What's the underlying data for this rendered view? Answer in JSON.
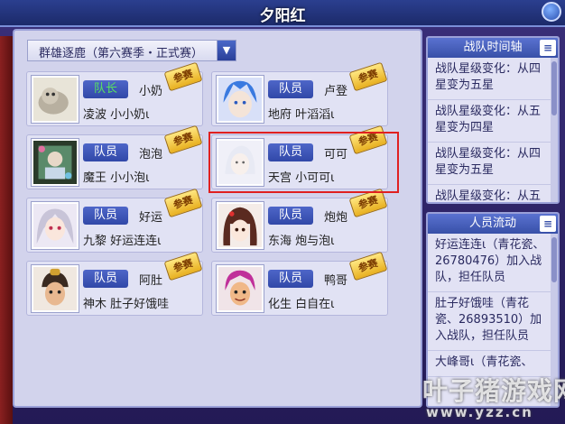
{
  "window": {
    "title": "夕阳红"
  },
  "season_select": {
    "label": "群雄逐鹿（第六赛季・正式赛）"
  },
  "badge_label": "参赛",
  "members": [
    {
      "role": "队长",
      "name": "小奶",
      "server": "凌波",
      "nick": "小小奶ι",
      "avatar": "avatar-cat"
    },
    {
      "role": "队员",
      "name": "卢登",
      "server": "地府",
      "nick": "叶滔滔ι",
      "avatar": "avatar-blue-hair"
    },
    {
      "role": "队员",
      "name": "泡泡",
      "server": "魔王",
      "nick": "小小泡ι",
      "avatar": "avatar-photo"
    },
    {
      "role": "队员",
      "name": "可可",
      "server": "天宫",
      "nick": "小可可ι",
      "avatar": "avatar-white"
    },
    {
      "role": "队员",
      "name": "好运",
      "server": "九黎",
      "nick": "好运连连ι",
      "avatar": "avatar-silver-hair"
    },
    {
      "role": "队员",
      "name": "炮炮",
      "server": "东海",
      "nick": "炮与泡ι",
      "avatar": "avatar-dark-hair"
    },
    {
      "role": "队员",
      "name": "阿肚",
      "server": "神木",
      "nick": "肚子好饿哇",
      "avatar": "avatar-warrior"
    },
    {
      "role": "队员",
      "name": "鸭哥",
      "server": "化生",
      "nick": "白自在ι",
      "avatar": "avatar-red-hair"
    }
  ],
  "timeline": {
    "title": "战队时间轴",
    "items": [
      "战队星级变化：从四星变为五星",
      "战队星级变化：从五星变为四星",
      "战队星级变化：从四星变为五星",
      "战队星级变化：从五"
    ]
  },
  "roster_flow": {
    "title": "人员流动",
    "items": [
      "好运连连ι（青花瓷、26780476）加入战队，担任队员",
      "肚子好饿哇（青花瓷、26893510）加入战队，担任队员",
      "大峰哥ι（青花瓷、"
    ]
  },
  "watermark": {
    "text": "叶子猪游戏网",
    "url": "www.yzz.cn"
  },
  "colors": {
    "panel_bg": "#d2d3ec",
    "header_blue": "#3850a8",
    "highlight": "#e02020",
    "badge_gold": "#e8b020"
  }
}
